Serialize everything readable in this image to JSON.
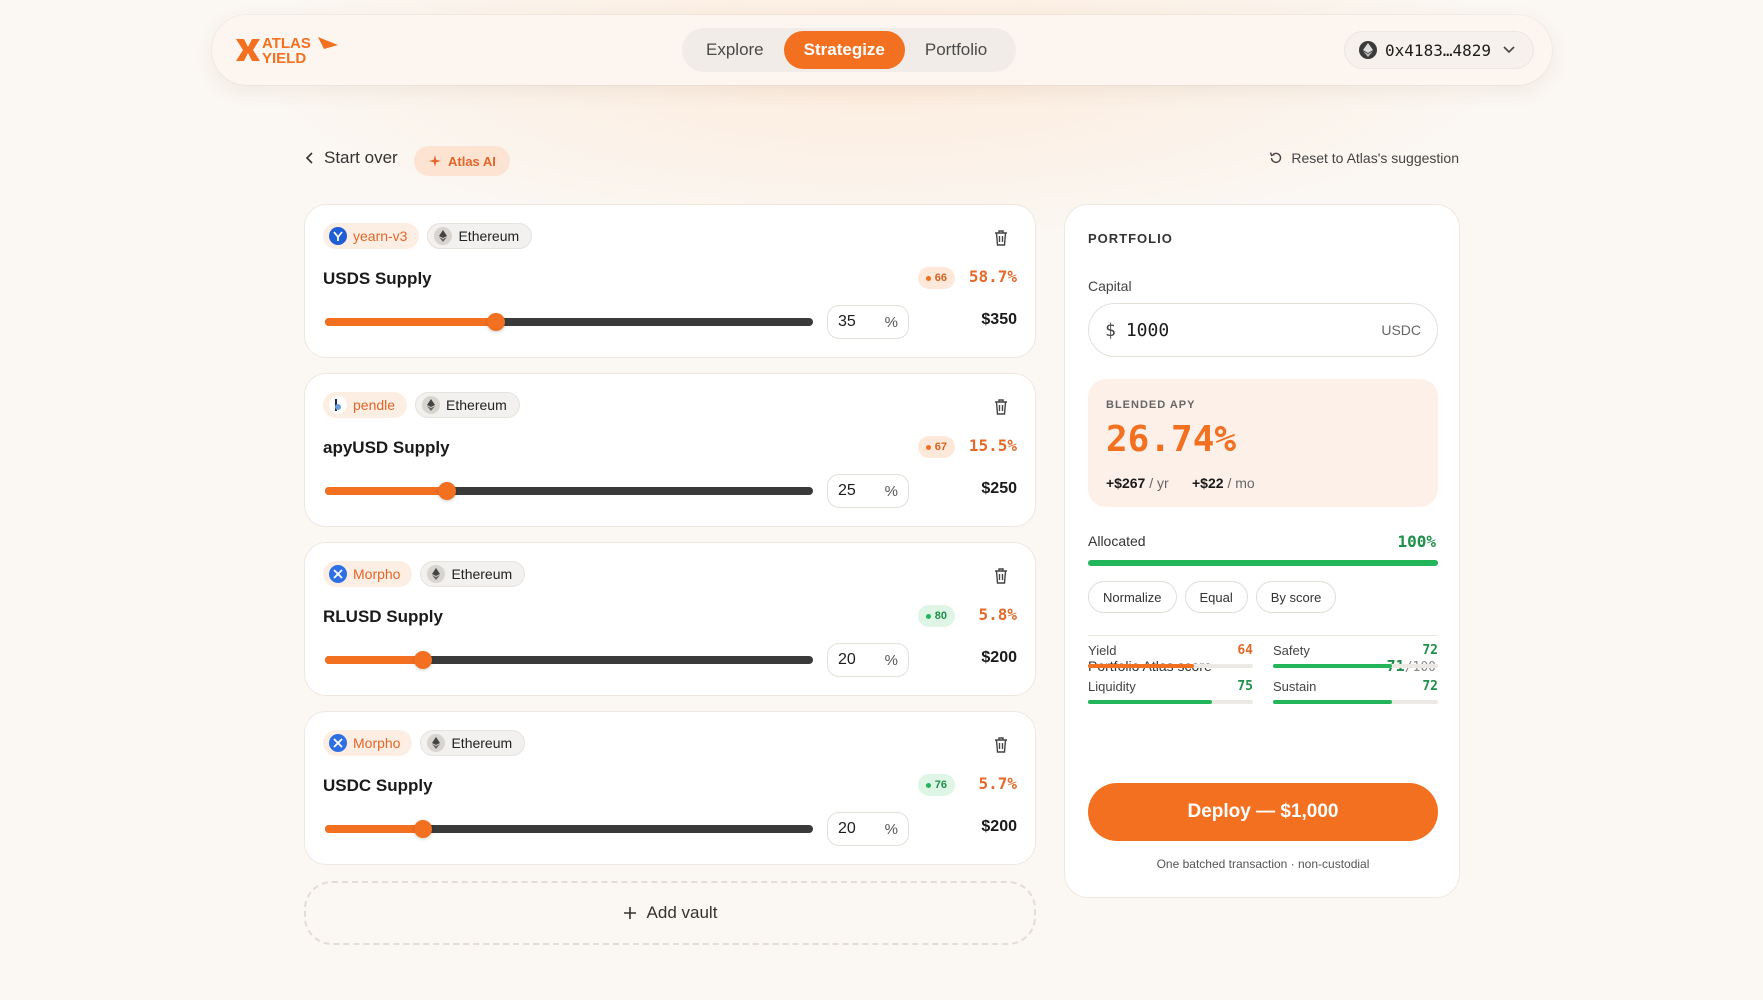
{
  "header": {
    "logo_text": "ATLAS YIELD",
    "nav": [
      {
        "label": "Explore",
        "active": false
      },
      {
        "label": "Strategize",
        "active": true
      },
      {
        "label": "Portfolio",
        "active": false
      }
    ],
    "wallet": {
      "address": "0x4183…4829",
      "icon": "ethereum-icon"
    }
  },
  "subbar": {
    "start_over": "Start over",
    "ai_badge": "Atlas AI",
    "reset": "Reset to Atlas's suggestion"
  },
  "vaults": [
    {
      "protocol": "yearn-v3",
      "protocol_icon": "yearn-icon",
      "network": "Ethereum",
      "name": "USDS Supply",
      "score": "66",
      "score_color": "orange",
      "apy": "58.7%",
      "percent": "35",
      "amount": "$350"
    },
    {
      "protocol": "pendle",
      "protocol_icon": "pendle-icon",
      "network": "Ethereum",
      "name": "apyUSD Supply",
      "score": "67",
      "score_color": "orange",
      "apy": "15.5%",
      "percent": "25",
      "amount": "$250"
    },
    {
      "protocol": "Morpho",
      "protocol_icon": "morpho-icon",
      "network": "Ethereum",
      "name": "RLUSD Supply",
      "score": "80",
      "score_color": "green",
      "apy": "5.8%",
      "percent": "20",
      "amount": "$200"
    },
    {
      "protocol": "Morpho",
      "protocol_icon": "morpho-icon",
      "network": "Ethereum",
      "name": "USDC Supply",
      "score": "76",
      "score_color": "green",
      "apy": "5.7%",
      "percent": "20",
      "amount": "$200"
    }
  ],
  "percent_symbol": "%",
  "add_vault": "Add vault",
  "portfolio": {
    "title": "PORTFOLIO",
    "capital_label": "Capital",
    "capital_symbol": "$",
    "capital_value": "1000",
    "capital_unit": "USDC",
    "blended_label": "BLENDED APY",
    "blended_value": "26.74%",
    "per_year_amount": "+$267",
    "per_year_unit": "/ yr",
    "per_month_amount": "+$22",
    "per_month_unit": "/ mo",
    "allocated_label": "Allocated",
    "allocated_value": "100%",
    "allocated_fraction": 1.0,
    "buttons": [
      "Normalize",
      "Equal",
      "By score"
    ],
    "score_label": "Portfolio Atlas score",
    "score_value": "71",
    "score_max": "/100",
    "metrics": [
      {
        "label": "Yield",
        "value": "64",
        "color": "#e5692a"
      },
      {
        "label": "Safety",
        "value": "72",
        "color": "#1f8f4a"
      },
      {
        "label": "Liquidity",
        "value": "75",
        "color": "#1f8f4a"
      },
      {
        "label": "Sustain",
        "value": "72",
        "color": "#1f8f4a"
      }
    ],
    "deploy_label": "Deploy — $1,000",
    "footnote": "One batched transaction · non-custodial"
  },
  "colors": {
    "accent": "#f37021",
    "green": "#22b55a"
  }
}
